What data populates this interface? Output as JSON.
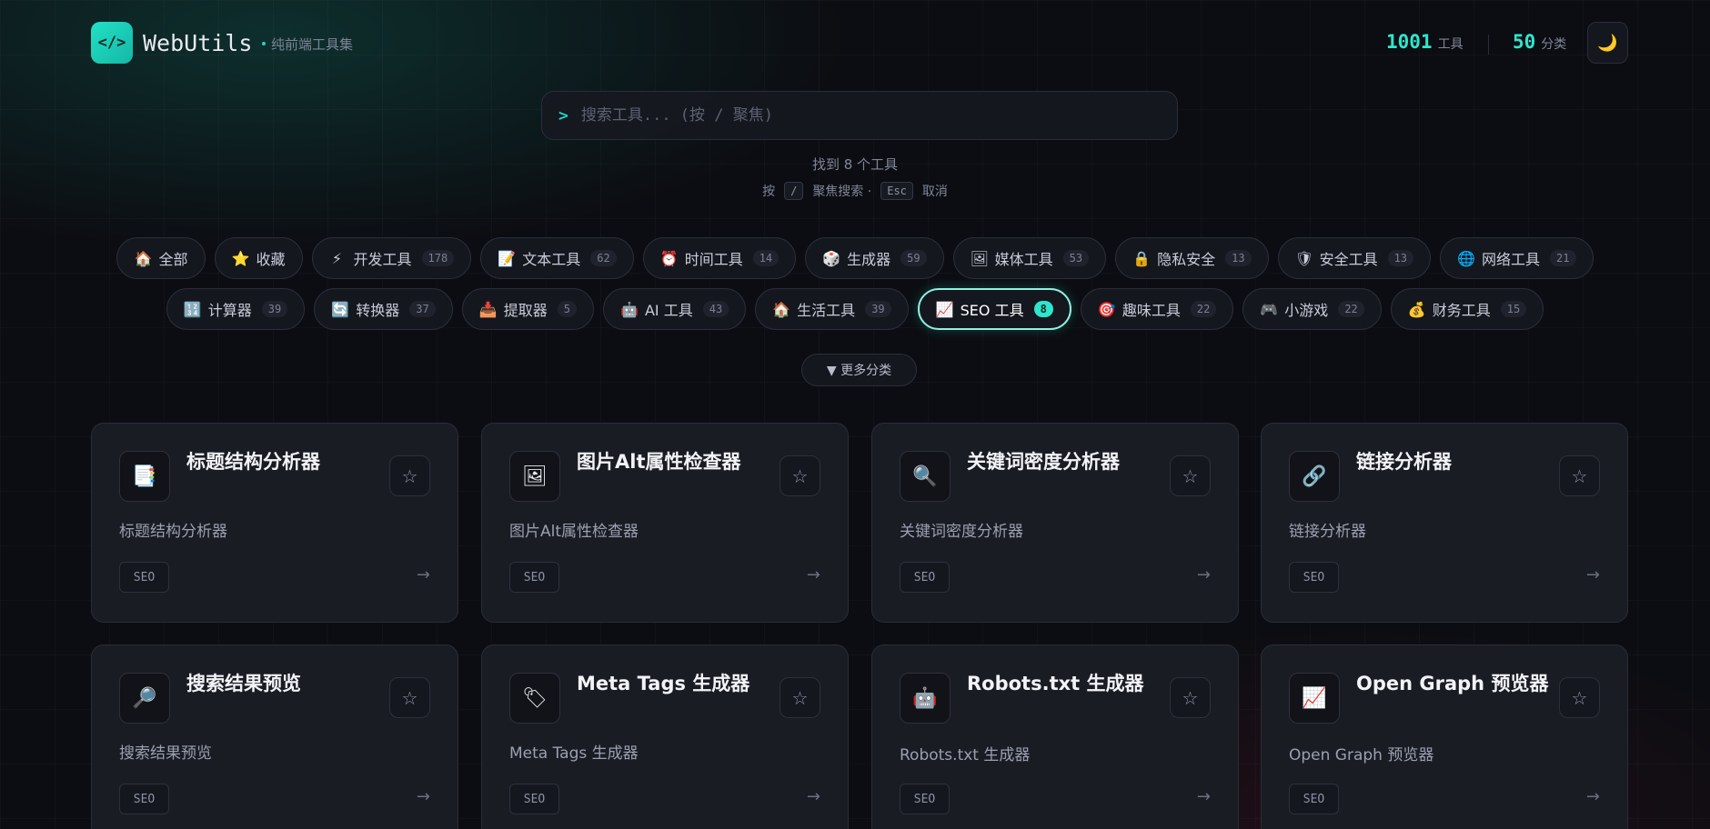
{
  "header": {
    "logo_glyph": "</>",
    "brand": "WebUtils",
    "tagline": "纯前端工具集",
    "tools_count": "1001",
    "tools_label": "工具",
    "categories_count": "50",
    "categories_label": "分类",
    "theme_icon": "🌙"
  },
  "search": {
    "prompt": ">",
    "placeholder": "搜索工具... (按 / 聚焦)",
    "found_text": "找到 8 个工具",
    "hint_press": "按",
    "hint_slash_key": "/",
    "hint_focus": "聚焦搜索 ·",
    "hint_esc_key": "Esc",
    "hint_cancel": "取消"
  },
  "categories_row1": [
    {
      "icon": "🏠",
      "label": "全部",
      "count": ""
    },
    {
      "icon": "⭐",
      "label": "收藏",
      "count": ""
    },
    {
      "icon": "⚡",
      "label": "开发工具",
      "count": "178"
    },
    {
      "icon": "📝",
      "label": "文本工具",
      "count": "62"
    },
    {
      "icon": "⏰",
      "label": "时间工具",
      "count": "14"
    },
    {
      "icon": "🎲",
      "label": "生成器",
      "count": "59"
    },
    {
      "icon": "🖼",
      "label": "媒体工具",
      "count": "53"
    },
    {
      "icon": "🔒",
      "label": "隐私安全",
      "count": "13"
    },
    {
      "icon": "🛡",
      "label": "安全工具",
      "count": "13"
    },
    {
      "icon": "🌐",
      "label": "网络工具",
      "count": "21"
    }
  ],
  "categories_row2": [
    {
      "icon": "🔢",
      "label": "计算器",
      "count": "39"
    },
    {
      "icon": "🔄",
      "label": "转换器",
      "count": "37"
    },
    {
      "icon": "📥",
      "label": "提取器",
      "count": "5"
    },
    {
      "icon": "🤖",
      "label": "AI 工具",
      "count": "43"
    },
    {
      "icon": "🏠",
      "label": "生活工具",
      "count": "39"
    },
    {
      "icon": "📈",
      "label": "SEO 工具",
      "count": "8"
    },
    {
      "icon": "🎯",
      "label": "趣味工具",
      "count": "22"
    },
    {
      "icon": "🎮",
      "label": "小游戏",
      "count": "22"
    },
    {
      "icon": "💰",
      "label": "财务工具",
      "count": "15"
    }
  ],
  "more_categories": "▼ 更多分类",
  "cards": [
    {
      "icon": "📑",
      "title": "标题结构分析器",
      "desc": "标题结构分析器",
      "tag": "SEO",
      "star": "☆",
      "arrow": "→"
    },
    {
      "icon": "🖼",
      "title": "图片Alt属性检查器",
      "desc": "图片Alt属性检查器",
      "tag": "SEO",
      "star": "☆",
      "arrow": "→"
    },
    {
      "icon": "🔍",
      "title": "关键词密度分析器",
      "desc": "关键词密度分析器",
      "tag": "SEO",
      "star": "☆",
      "arrow": "→"
    },
    {
      "icon": "🔗",
      "title": "链接分析器",
      "desc": "链接分析器",
      "tag": "SEO",
      "star": "☆",
      "arrow": "→"
    },
    {
      "icon": "🔎",
      "title": "搜索结果预览",
      "desc": "搜索结果预览",
      "tag": "SEO",
      "star": "☆",
      "arrow": "→"
    },
    {
      "icon": "🏷",
      "title": "Meta Tags 生成器",
      "desc": "Meta Tags 生成器",
      "tag": "SEO",
      "star": "☆",
      "arrow": "→"
    },
    {
      "icon": "🤖",
      "title": "Robots.txt 生成器",
      "desc": "Robots.txt 生成器",
      "tag": "SEO",
      "star": "☆",
      "arrow": "→"
    },
    {
      "icon": "📈",
      "title": "Open Graph 预览器",
      "desc": "Open Graph 预览器",
      "tag": "SEO",
      "star": "☆",
      "arrow": "→"
    }
  ]
}
